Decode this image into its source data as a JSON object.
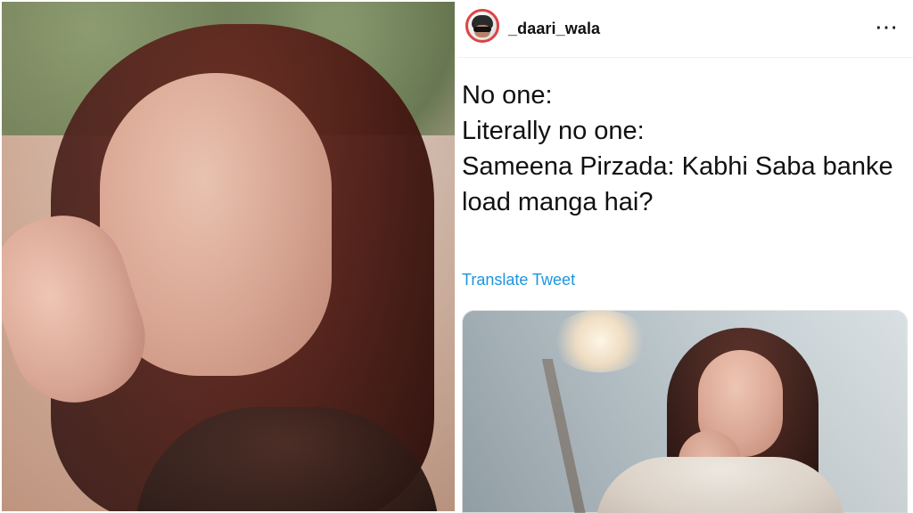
{
  "post": {
    "username": "_daari_wala",
    "more_icon": "more-horizontal-icon",
    "text_lines": [
      "No one:",
      "Literally no one:",
      "Sameena Pirzada: Kabhi Saba banke",
      "load manga hai?"
    ],
    "translate_label": "Translate Tweet"
  },
  "colors": {
    "link_blue": "#1b95e0",
    "text_dark": "#111111",
    "divider": "#ffffff"
  }
}
